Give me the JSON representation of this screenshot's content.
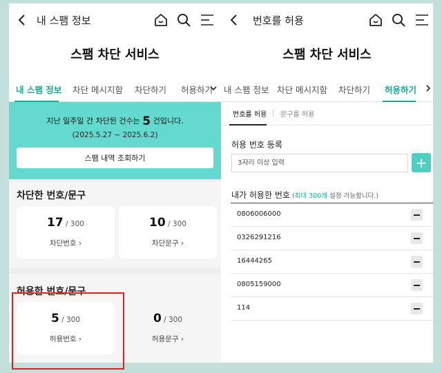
{
  "left": {
    "appbar": {
      "title": "내 스팸 정보"
    },
    "page_title": "스팸 차단 서비스",
    "tabs": [
      {
        "label": "내 스팸 정보"
      },
      {
        "label": "차단 메시지함"
      },
      {
        "label": "차단하기"
      },
      {
        "label": "허용하기"
      }
    ],
    "banner": {
      "text_before": "지난 일주일 간 차단된 건수는 ",
      "count": "5",
      "text_after": " 건입니다.",
      "range": "(2025.5.27 ~ 2025.6.2)",
      "button_label": "스팸 내역 조회하기"
    },
    "blocked": {
      "title": "차단한 번호/문구",
      "cards": [
        {
          "value": "17",
          "max": " / 300",
          "link": "차단번호"
        },
        {
          "value": "10",
          "max": " / 300",
          "link": "차단문구"
        }
      ]
    },
    "allowed": {
      "title": "허용한 번호/문구",
      "cards": [
        {
          "value": "5",
          "max": " / 300",
          "link": "허용번호"
        },
        {
          "value": "0",
          "max": " / 300",
          "link": "허용문구"
        }
      ]
    }
  },
  "right": {
    "appbar": {
      "title": "번호를 허용"
    },
    "page_title": "스팸 차단 서비스",
    "tabs": [
      {
        "label": "내 스팸 정보"
      },
      {
        "label": "차단 메시지함"
      },
      {
        "label": "차단하기"
      },
      {
        "label": "허용하기"
      }
    ],
    "subtabs": [
      {
        "label": "번호를 허용"
      },
      {
        "label": "문구를 허용"
      }
    ],
    "register": {
      "label": "허용 번호 등록",
      "placeholder": "3자리 이상 입력",
      "add_label": "+"
    },
    "list": {
      "title": "내가 허용한 번호",
      "note_open": " (",
      "note_highlight": "최대 300개",
      "note_rest": " 설정 가능합니다.)",
      "numbers": [
        "0806006000",
        "0326291216",
        "16444265",
        "0805159000",
        "114"
      ]
    }
  },
  "colors": {
    "accent": "#1da89a",
    "banner": "#63d9cf",
    "add_button": "#4dd0c3",
    "highlight_border": "#e02020",
    "frame_background": "#c2dfd9"
  }
}
